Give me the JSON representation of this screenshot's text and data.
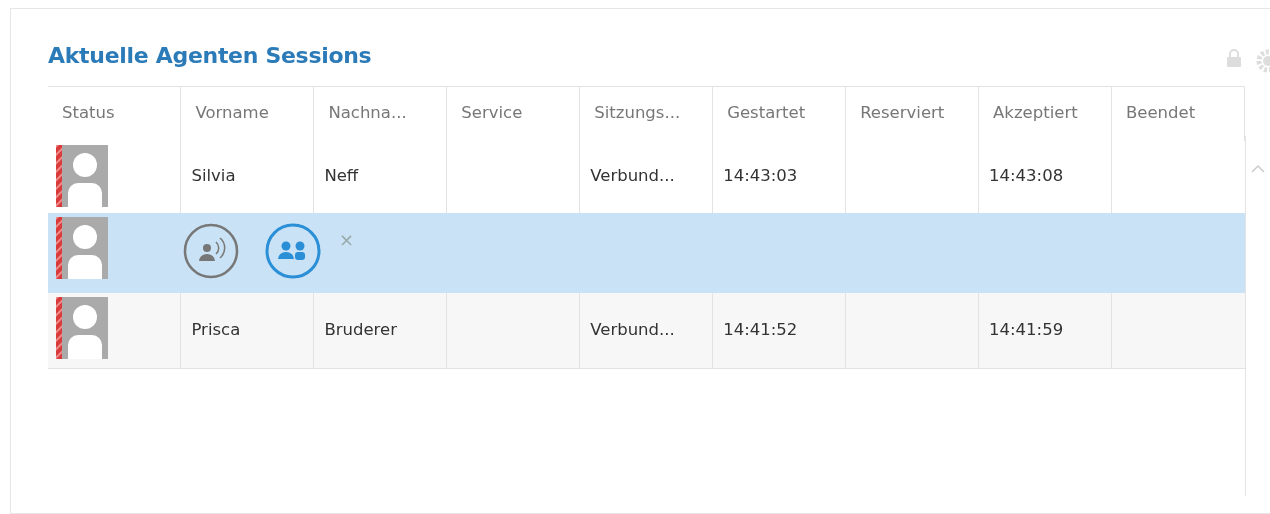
{
  "panel": {
    "title": "Aktuelle Agenten Sessions"
  },
  "table": {
    "columns": [
      "Status",
      "Vorname",
      "Nachna...",
      "Service",
      "Sitzungs...",
      "Gestartet",
      "Reserviert",
      "Akzeptiert",
      "Beendet"
    ],
    "rows": [
      {
        "kind": "session",
        "selected": false,
        "cells": [
          "Silvia",
          "Neff",
          "",
          "Verbund...",
          "14:43:03",
          "",
          "14:43:08",
          ""
        ]
      },
      {
        "kind": "actions",
        "selected": true,
        "close": "×"
      },
      {
        "kind": "session",
        "selected": false,
        "cells": [
          "Prisca",
          "Bruderer",
          "",
          "Verbund...",
          "14:41:52",
          "",
          "14:41:59",
          ""
        ]
      }
    ]
  }
}
